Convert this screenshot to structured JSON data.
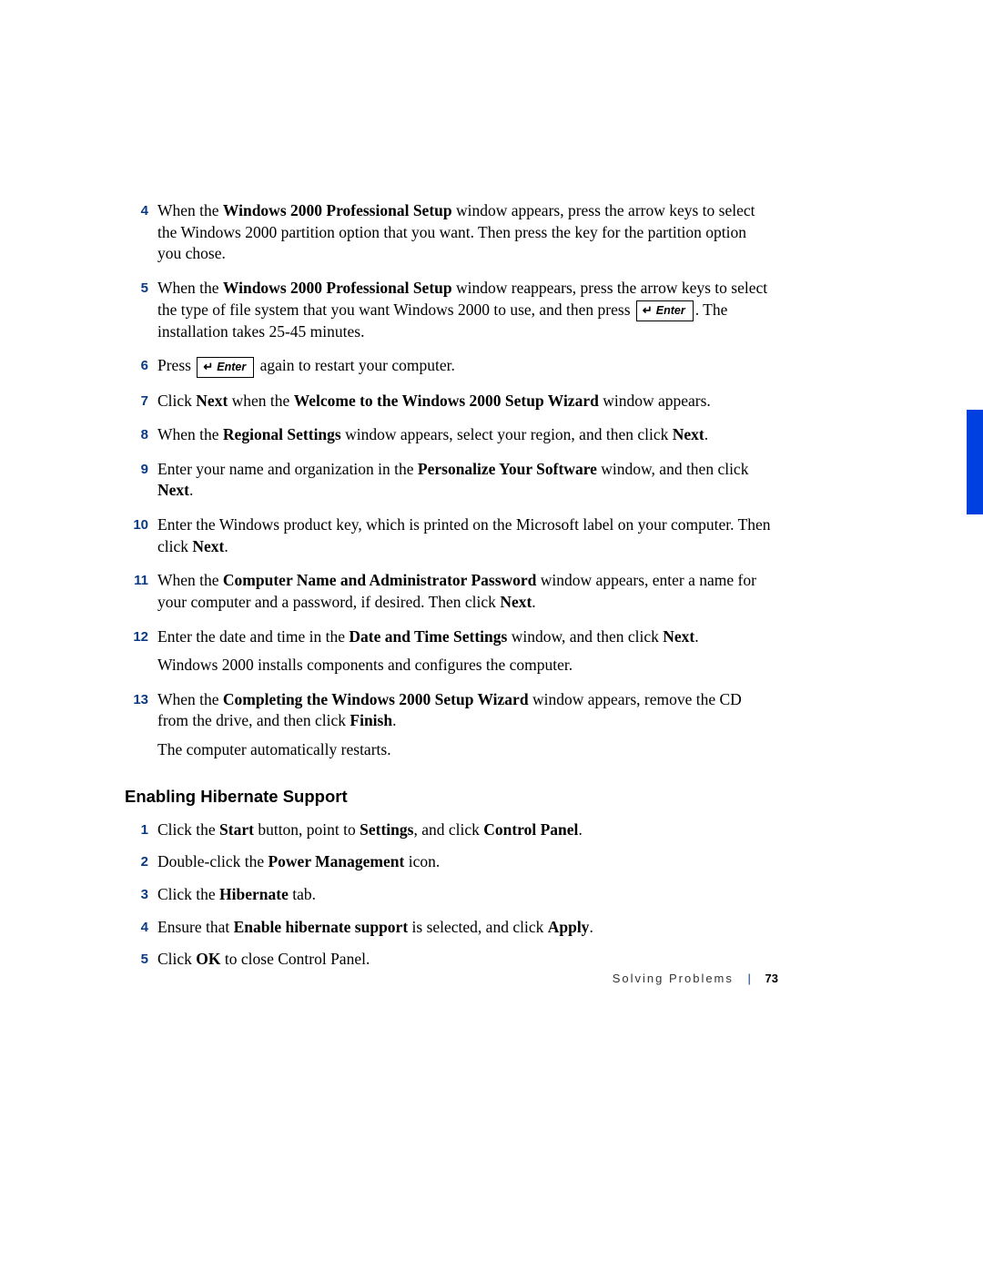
{
  "steps": {
    "s4": {
      "num": "4",
      "t1": "When the ",
      "b1": "Windows 2000 Professional Setup",
      "t2": " window appears, press the arrow keys to select the Windows 2000 partition option that you want. Then press the key for the partition option you chose."
    },
    "s5": {
      "num": "5",
      "t1": "When the ",
      "b1": "Windows 2000 Professional Setup",
      "t2": " window reappears, press the arrow keys to select the type of file system that you want Windows 2000 to use, and then press ",
      "key": "Enter",
      "t3": ". The installation takes 25-45 minutes."
    },
    "s6": {
      "num": "6",
      "t1": "Press ",
      "key": "Enter",
      "t2": " again to restart your computer."
    },
    "s7": {
      "num": "7",
      "t1": "Click ",
      "b1": "Next",
      "t2": " when the ",
      "b2": "Welcome to the Windows 2000 Setup Wizard",
      "t3": " window appears."
    },
    "s8": {
      "num": "8",
      "t1": "When the ",
      "b1": "Regional Settings",
      "t2": " window appears, select your region, and then click ",
      "b2": "Next",
      "t3": "."
    },
    "s9": {
      "num": "9",
      "t1": "Enter your name and organization in the ",
      "b1": "Personalize Your Software",
      "t2": " window, and then click ",
      "b2": "Next",
      "t3": "."
    },
    "s10": {
      "num": "10",
      "t1": "Enter the Windows product key, which is printed on the Microsoft label on your computer. Then click ",
      "b1": "Next",
      "t2": "."
    },
    "s11": {
      "num": "11",
      "t1": "When the ",
      "b1": "Computer Name and Administrator Password",
      "t2": " window appears, enter a name for your computer and a password, if desired. Then click ",
      "b2": "Next",
      "t3": "."
    },
    "s12": {
      "num": "12",
      "t1": "Enter the date and time in the ",
      "b1": "Date and Time Settings",
      "t2": " window, and then click ",
      "b2": "Next",
      "t3": ".",
      "after": "Windows 2000 installs components and configures the computer."
    },
    "s13": {
      "num": "13",
      "t1": "When the ",
      "b1": "Completing the Windows 2000 Setup Wizard",
      "t2": " window appears, remove the CD from the drive, and then click ",
      "b2": "Finish",
      "t3": ".",
      "after": "The computer automatically restarts."
    }
  },
  "section2": {
    "title": "Enabling Hibernate Support",
    "steps": {
      "h1": {
        "num": "1",
        "t1": "Click the ",
        "b1": "Start",
        "t2": " button, point to ",
        "b2": "Settings",
        "t3": ", and click ",
        "b3": "Control Panel",
        "t4": "."
      },
      "h2": {
        "num": "2",
        "t1": "Double-click the ",
        "b1": "Power Management",
        "t2": " icon."
      },
      "h3": {
        "num": "3",
        "t1": "Click the ",
        "b1": "Hibernate",
        "t2": " tab."
      },
      "h4": {
        "num": "4",
        "t1": "Ensure that ",
        "b1": "Enable hibernate support",
        "t2": " is selected, and click ",
        "b2": "Apply",
        "t3": "."
      },
      "h5": {
        "num": "5",
        "t1": "Click ",
        "b1": "OK",
        "t2": " to close Control Panel."
      }
    }
  },
  "footer": {
    "section": "Solving Problems",
    "page": "73"
  }
}
